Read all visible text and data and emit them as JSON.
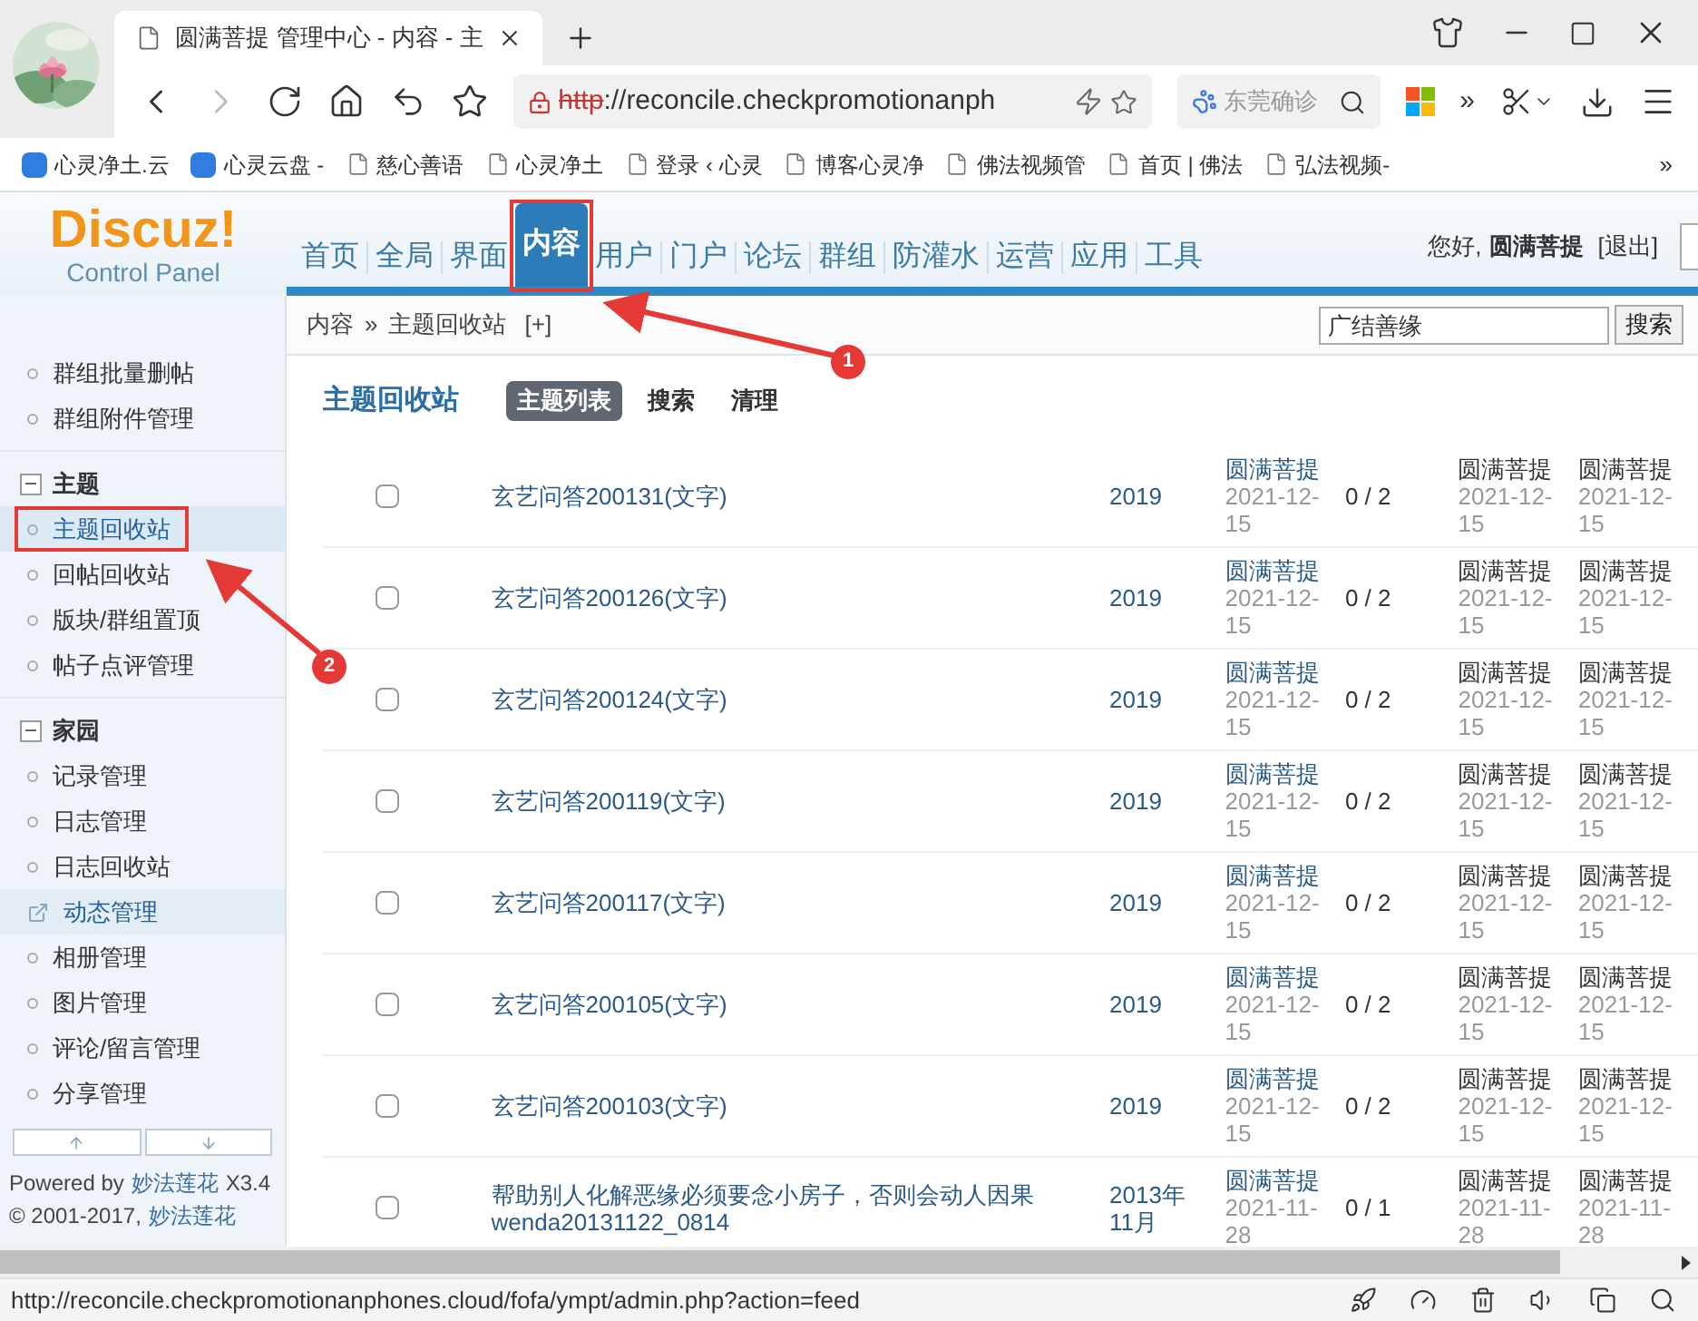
{
  "browser": {
    "tab": {
      "title": "圆满菩提 管理中心 - 内容 - 主",
      "selected": true
    },
    "address": {
      "scheme": "http",
      "rest": "://reconcile.checkpromotionanph"
    },
    "search": {
      "value": "东莞确诊"
    },
    "overflow": "»",
    "bookmarks": [
      {
        "label": "心灵净土.云",
        "kind": "app"
      },
      {
        "label": "心灵云盘 -",
        "kind": "app"
      },
      {
        "label": "慈心善语",
        "kind": "page"
      },
      {
        "label": "心灵净土",
        "kind": "page"
      },
      {
        "label": "登录 ‹ 心灵",
        "kind": "page"
      },
      {
        "label": "博客心灵净",
        "kind": "page"
      },
      {
        "label": "佛法视频管",
        "kind": "page"
      },
      {
        "label": "首页 | 佛法",
        "kind": "page"
      },
      {
        "label": "弘法视频-",
        "kind": "page"
      }
    ],
    "bookmarks_more": "»"
  },
  "header": {
    "logo": "Discuz!",
    "subtitle": "Control Panel",
    "nav": [
      {
        "label": "首页",
        "selected": false
      },
      {
        "label": "全局",
        "selected": false
      },
      {
        "label": "界面",
        "selected": false
      },
      {
        "label": "内容",
        "selected": true
      },
      {
        "label": "用户",
        "selected": false
      },
      {
        "label": "门户",
        "selected": false
      },
      {
        "label": "论坛",
        "selected": false
      },
      {
        "label": "群组",
        "selected": false
      },
      {
        "label": "防灌水",
        "selected": false
      },
      {
        "label": "运营",
        "selected": false
      },
      {
        "label": "应用",
        "selected": false
      },
      {
        "label": "工具",
        "selected": false
      }
    ],
    "user": {
      "greeting": "您好,",
      "name": "圆满菩提",
      "logout": "[退出]"
    }
  },
  "breadcrumb": {
    "items": [
      "内容",
      "主题回收站"
    ],
    "separator": "»",
    "add": "[+]"
  },
  "search": {
    "value": "广结善缘",
    "button": "搜索"
  },
  "sidebar": {
    "groups": [
      {
        "items": [
          {
            "label": "群组批量删帖",
            "kind": "page",
            "selected": false
          },
          {
            "label": "群组附件管理",
            "kind": "page",
            "selected": false
          }
        ]
      },
      {
        "title": "主题",
        "expanded": true,
        "items": [
          {
            "label": "主题回收站",
            "kind": "page",
            "selected": true
          },
          {
            "label": "回帖回收站",
            "kind": "page",
            "selected": false
          },
          {
            "label": "版块/群组置顶",
            "kind": "page",
            "selected": false
          },
          {
            "label": "帖子点评管理",
            "kind": "page",
            "selected": false
          }
        ]
      },
      {
        "title": "家园",
        "expanded": true,
        "items": [
          {
            "label": "记录管理",
            "kind": "page",
            "selected": false
          },
          {
            "label": "日志管理",
            "kind": "page",
            "selected": false
          },
          {
            "label": "日志回收站",
            "kind": "page",
            "selected": false
          },
          {
            "label": "动态管理",
            "kind": "external",
            "selected": false
          },
          {
            "label": "相册管理",
            "kind": "page",
            "selected": false
          },
          {
            "label": "图片管理",
            "kind": "page",
            "selected": false
          },
          {
            "label": "评论/留言管理",
            "kind": "page",
            "selected": false
          },
          {
            "label": "分享管理",
            "kind": "page",
            "selected": false
          }
        ]
      }
    ],
    "powered": {
      "prefix": "Powered by",
      "link": "妙法莲花",
      "suffix": "X3.4"
    },
    "copyright": {
      "prefix": "© 2001-2017,",
      "link": "妙法莲花"
    }
  },
  "main": {
    "title": "主题回收站",
    "tabs": [
      {
        "label": "主题列表",
        "selected": true
      },
      {
        "label": "搜索",
        "selected": false
      },
      {
        "label": "清理",
        "selected": false
      }
    ],
    "rows": [
      {
        "checked": false,
        "title": "玄艺问答200131(文字)",
        "forum": "2019",
        "author": "圆满菩提",
        "date": "2021-12-15",
        "replies": "0 / 2",
        "column_6": {
          "name": "圆满菩提",
          "date": "2021-12-15"
        },
        "column_7": {
          "name": "圆满菩提",
          "date": "2021-12-15"
        }
      },
      {
        "checked": false,
        "title": "玄艺问答200126(文字)",
        "forum": "2019",
        "author": "圆满菩提",
        "date": "2021-12-15",
        "replies": "0 / 2",
        "column_6": {
          "name": "圆满菩提",
          "date": "2021-12-15"
        },
        "column_7": {
          "name": "圆满菩提",
          "date": "2021-12-15"
        }
      },
      {
        "checked": false,
        "title": "玄艺问答200124(文字)",
        "forum": "2019",
        "author": "圆满菩提",
        "date": "2021-12-15",
        "replies": "0 / 2",
        "column_6": {
          "name": "圆满菩提",
          "date": "2021-12-15"
        },
        "column_7": {
          "name": "圆满菩提",
          "date": "2021-12-15"
        }
      },
      {
        "checked": false,
        "title": "玄艺问答200119(文字)",
        "forum": "2019",
        "author": "圆满菩提",
        "date": "2021-12-15",
        "replies": "0 / 2",
        "column_6": {
          "name": "圆满菩提",
          "date": "2021-12-15"
        },
        "column_7": {
          "name": "圆满菩提",
          "date": "2021-12-15"
        }
      },
      {
        "checked": false,
        "title": "玄艺问答200117(文字)",
        "forum": "2019",
        "author": "圆满菩提",
        "date": "2021-12-15",
        "replies": "0 / 2",
        "column_6": {
          "name": "圆满菩提",
          "date": "2021-12-15"
        },
        "column_7": {
          "name": "圆满菩提",
          "date": "2021-12-15"
        }
      },
      {
        "checked": false,
        "title": "玄艺问答200105(文字)",
        "forum": "2019",
        "author": "圆满菩提",
        "date": "2021-12-15",
        "replies": "0 / 2",
        "column_6": {
          "name": "圆满菩提",
          "date": "2021-12-15"
        },
        "column_7": {
          "name": "圆满菩提",
          "date": "2021-12-15"
        }
      },
      {
        "checked": false,
        "title": "玄艺问答200103(文字)",
        "forum": "2019",
        "author": "圆满菩提",
        "date": "2021-12-15",
        "replies": "0 / 2",
        "column_6": {
          "name": "圆满菩提",
          "date": "2021-12-15"
        },
        "column_7": {
          "name": "圆满菩提",
          "date": "2021-12-15"
        }
      },
      {
        "checked": false,
        "title": "帮助别人化解恶缘必须要念小房子，否则会动人因果 wenda20131122_0814",
        "forum": "2013年11月",
        "author": "圆满菩提",
        "date": "2021-11-28",
        "replies": "0 / 1",
        "column_6": {
          "name": "圆满菩提",
          "date": "2021-11-28"
        },
        "column_7": {
          "name": "圆满菩提",
          "date": "2021-11-28"
        }
      }
    ]
  },
  "annotations": [
    {
      "label": "1"
    },
    {
      "label": "2"
    }
  ],
  "status_bar": {
    "url": "http://reconcile.checkpromotionanphones.cloud/fofa/ympt/admin.php?action=feed"
  }
}
